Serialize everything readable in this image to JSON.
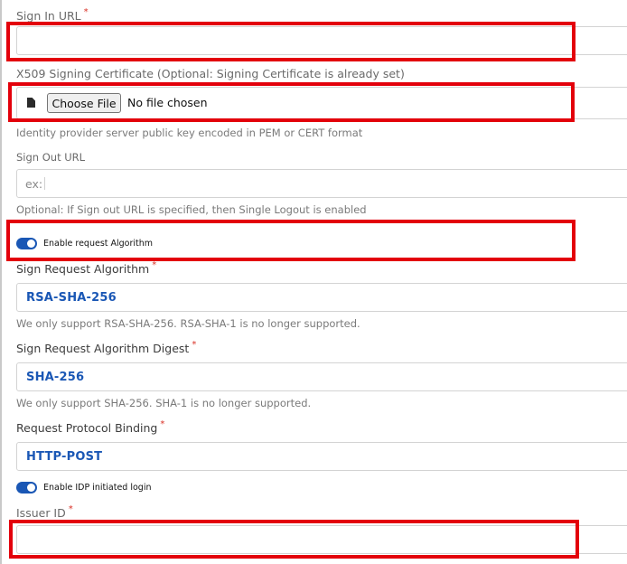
{
  "signin": {
    "label": "Sign In URL",
    "required": "*",
    "value": ""
  },
  "cert": {
    "label": "X509 Signing Certificate (Optional: Signing Certificate is already set)",
    "button": "Choose File",
    "status": "No file chosen",
    "help": "Identity provider server public key encoded in PEM or CERT format",
    "icon": "document-icon"
  },
  "signout": {
    "label": "Sign Out URL",
    "placeholder": "ex:",
    "help": "Optional: If Sign out URL is specified, then Single Logout is enabled"
  },
  "enable_request_algorithm": {
    "label": "Enable request Algorithm",
    "on": true
  },
  "sign_request_algorithm": {
    "label": "Sign Request Algorithm",
    "required": "*",
    "value": "RSA-SHA-256",
    "help": "We only support RSA-SHA-256. RSA-SHA-1 is no longer supported."
  },
  "sign_request_digest": {
    "label": "Sign Request Algorithm Digest",
    "required": "*",
    "value": "SHA-256",
    "help": "We only support SHA-256. SHA-1 is no longer supported."
  },
  "protocol_binding": {
    "label": "Request Protocol Binding",
    "required": "*",
    "value": "HTTP-POST"
  },
  "enable_idp_login": {
    "label": "Enable IDP initiated login",
    "on": true
  },
  "issuer": {
    "label": "Issuer ID",
    "required": "*",
    "value": ""
  },
  "colors": {
    "accent": "#1a57b5",
    "highlight": "#e3000b",
    "required": "#d93025"
  }
}
